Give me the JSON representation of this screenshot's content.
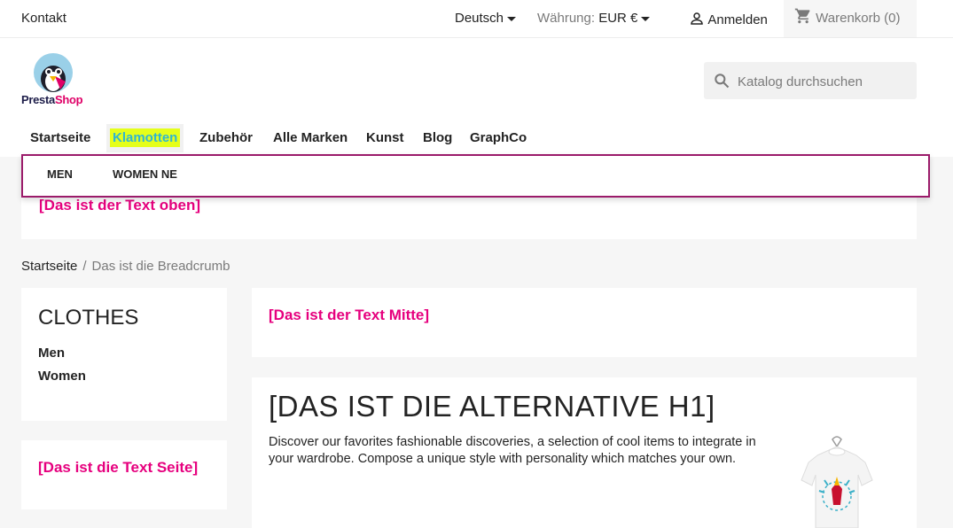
{
  "topbar": {
    "contact": "Kontakt",
    "language": "Deutsch",
    "currency_label": "Währung:",
    "currency_value": "EUR €",
    "login": "Anmelden",
    "cart": "Warenkorb (0)"
  },
  "logo": {
    "part1": "Presta",
    "part2": "Shop"
  },
  "search": {
    "placeholder": "Katalog durchsuchen"
  },
  "nav": {
    "items": [
      "Startseite",
      "Klamotten",
      "Zubehör",
      "Alle Marken",
      "Kunst",
      "Blog",
      "GraphCo"
    ]
  },
  "submenu": {
    "items": [
      "MEN",
      "WOMEN NE"
    ]
  },
  "banner_top": "[Das ist der Text oben]",
  "breadcrumb": {
    "home": "Startseite",
    "current": "Das ist die Breadcrumb"
  },
  "category": {
    "title": "CLOTHES",
    "items": [
      "Men",
      "Women"
    ]
  },
  "side_text": "[Das ist die Text Seite]",
  "mid_text": "[Das ist der Text Mitte]",
  "main": {
    "h1": "[DAS IST DIE ALTERNATIVE H1]",
    "description": "Discover our favorites fashionable discoveries, a selection of cool items to integrate in your wardrobe. Compose a unique style with personality which matches your own."
  },
  "colors": {
    "accent_pink": "#e6007e",
    "highlight": "#e5ff1a",
    "link_blue": "#2fb5d2",
    "menu_border": "#9b1b6a"
  },
  "icons": {
    "login": "person-icon",
    "cart": "shopping-cart-icon",
    "search": "search-icon"
  }
}
